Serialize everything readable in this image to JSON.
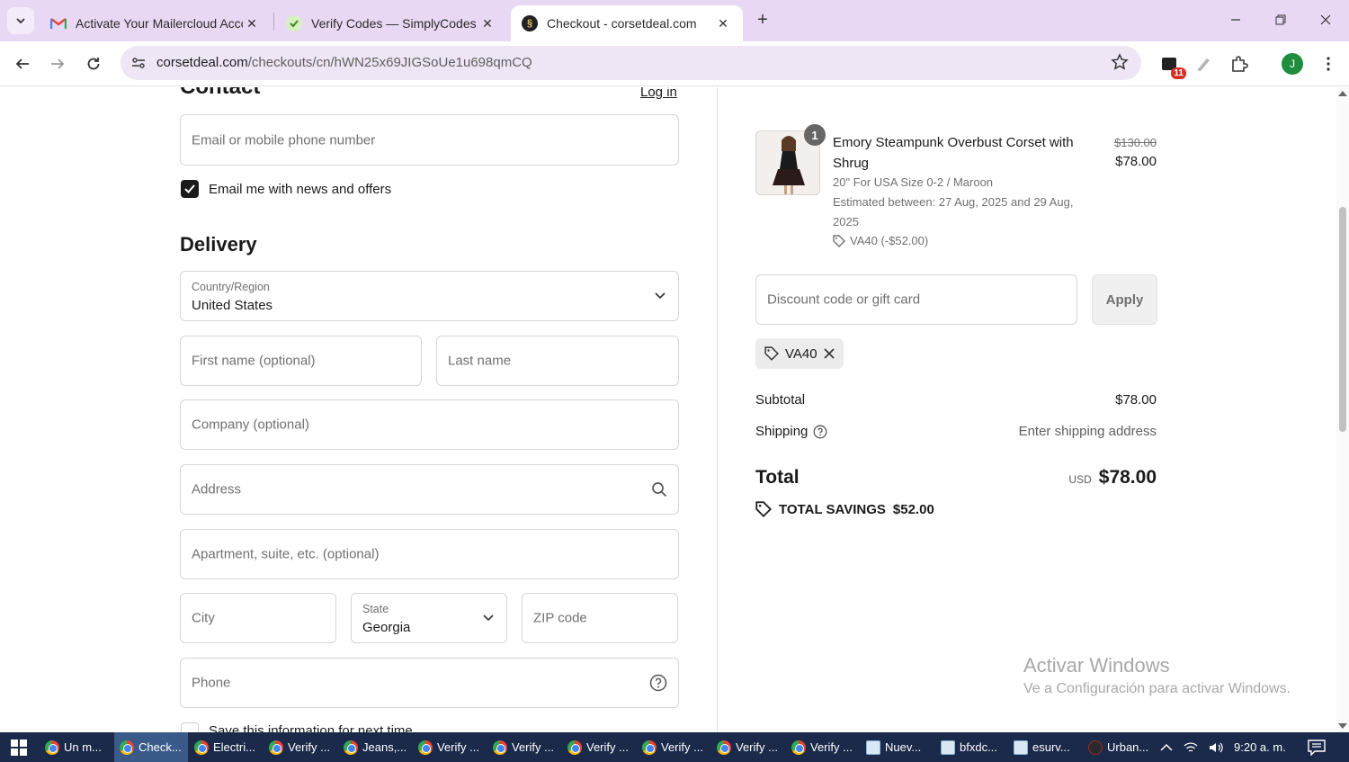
{
  "browser": {
    "tabs": [
      {
        "title": "Activate Your Mailercloud Acco",
        "favicon": "gmail-icon"
      },
      {
        "title": "Verify Codes — SimplyCodes",
        "favicon": "simplycodes-icon"
      },
      {
        "title": "Checkout - corsetdeal.com",
        "favicon": "corsetdeal-icon",
        "active": true
      }
    ],
    "url_domain": "corsetdeal.com",
    "url_path": "/checkouts/cn/hWN25x69JIGSoUe1u698qmCQ",
    "extension_badge": "11",
    "profile_initial": "J"
  },
  "contact": {
    "heading": "Contact",
    "login": "Log in",
    "email_placeholder": "Email or mobile phone number",
    "news_label": "Email me with news and offers"
  },
  "delivery": {
    "heading": "Delivery",
    "country_label": "Country/Region",
    "country_value": "United States",
    "first_name_placeholder": "First name (optional)",
    "last_name_placeholder": "Last name",
    "company_placeholder": "Company (optional)",
    "address_placeholder": "Address",
    "apartment_placeholder": "Apartment, suite, etc. (optional)",
    "city_placeholder": "City",
    "state_label": "State",
    "state_value": "Georgia",
    "zip_placeholder": "ZIP code",
    "phone_placeholder": "Phone",
    "save_info_label": "Save this information for next time"
  },
  "summary": {
    "product": {
      "quantity": "1",
      "name": "Emory Steampunk Overbust Corset with Shrug",
      "variant": "20\" For USA Size 0-2 / Maroon",
      "estimate": "Estimated between: 27 Aug, 2025 and 29 Aug, 2025",
      "discount": "VA40 (-$52.00)",
      "original_price": "$130.00",
      "price": "$78.00"
    },
    "discount_placeholder": "Discount code or gift card",
    "apply_label": "Apply",
    "applied_code": "VA40",
    "subtotal_label": "Subtotal",
    "subtotal_value": "$78.00",
    "shipping_label": "Shipping",
    "shipping_value": "Enter shipping address",
    "total_label": "Total",
    "total_currency": "USD",
    "total_value": "$78.00",
    "savings_label": "TOTAL SAVINGS",
    "savings_value": "$52.00"
  },
  "watermark": {
    "line1": "Activar Windows",
    "line2": "Ve a Configuración para activar Windows."
  },
  "taskbar": {
    "items": [
      {
        "label": "Un m...",
        "icon": "chrome-icon"
      },
      {
        "label": "Check...",
        "icon": "chrome-icon",
        "active": true
      },
      {
        "label": "Electri...",
        "icon": "chrome-icon"
      },
      {
        "label": "Verify ...",
        "icon": "chrome-icon"
      },
      {
        "label": "Jeans,...",
        "icon": "chrome-icon"
      },
      {
        "label": "Verify ...",
        "icon": "chrome-icon"
      },
      {
        "label": "Verify ...",
        "icon": "chrome-icon"
      },
      {
        "label": "Verify ...",
        "icon": "chrome-icon"
      },
      {
        "label": "Verify ...",
        "icon": "chrome-icon"
      },
      {
        "label": "Verify ...",
        "icon": "chrome-icon"
      },
      {
        "label": "Verify ...",
        "icon": "chrome-icon"
      },
      {
        "label": "Nuev...",
        "icon": "notepad-icon"
      },
      {
        "label": "bfxdc...",
        "icon": "notepad-icon"
      },
      {
        "label": "esurv...",
        "icon": "notepad-icon"
      },
      {
        "label": "Urban...",
        "icon": "app-icon"
      }
    ],
    "time": "9:20 a. m."
  }
}
